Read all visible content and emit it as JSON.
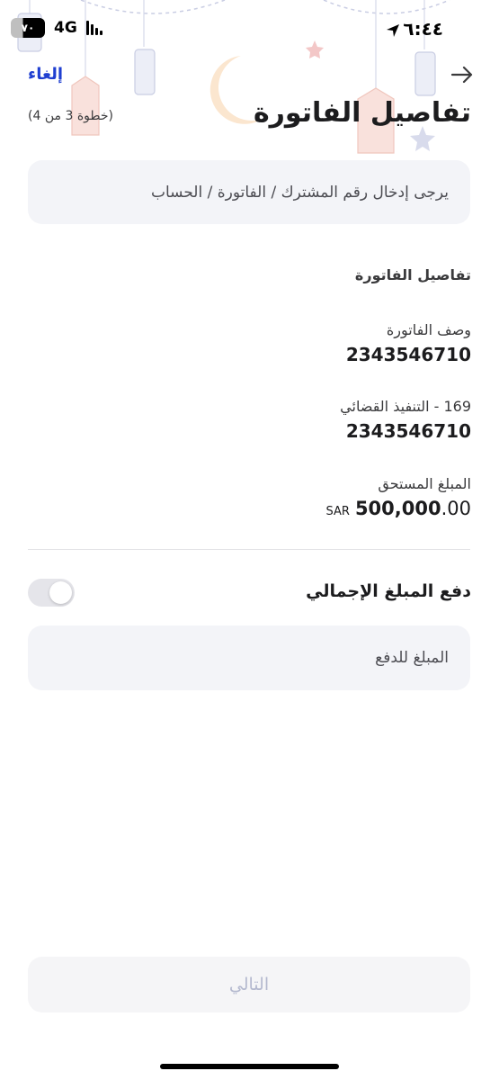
{
  "status_bar": {
    "time": "٦:٤٤",
    "battery": "٧٠",
    "network": "4G"
  },
  "header": {
    "cancel_label": "إلغاء",
    "title": "تفاصيل الفاتورة",
    "step": "(خطوة 3 من 4)"
  },
  "hint": "يرجى إدخال رقم المشترك / الفاتورة / الحساب",
  "details": {
    "section_label": "تفاصيل الفاتورة",
    "fields": [
      {
        "label": "وصف الفاتورة",
        "value": "2343546710"
      },
      {
        "label": "169 - التنفيذ القضائي",
        "value": "2343546710"
      }
    ],
    "due": {
      "label": "المبلغ المستحق",
      "currency": "SAR",
      "amount_whole": "500,000",
      "amount_decimal": ".00"
    }
  },
  "pay_total": {
    "label": "دفع المبلغ الإجمالي",
    "enabled": false
  },
  "amount_input": {
    "placeholder": "المبلغ للدفع",
    "value": ""
  },
  "next_button": {
    "label": "التالي",
    "disabled": true
  },
  "colors": {
    "accent": "#1f3fd1",
    "field_bg": "#f3f4f8",
    "disabled_text": "#b4b9cf"
  }
}
